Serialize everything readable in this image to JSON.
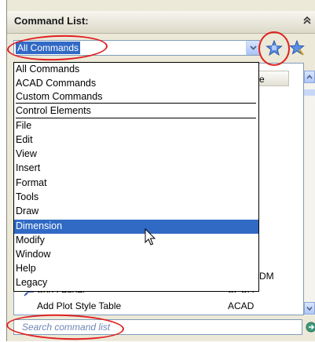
{
  "panel": {
    "title": "Command List:",
    "collapse_icon": "double-chevron-up-icon"
  },
  "filter": {
    "selected": "All Commands",
    "find_star_icon": "star-find-icon",
    "button_star_icon": "star-pin-icon"
  },
  "dropdown": {
    "items": [
      {
        "label": "All Commands"
      },
      {
        "label": "ACAD Commands"
      },
      {
        "label": "Custom Commands"
      },
      {
        "label": "Control Elements"
      },
      {
        "label": "File"
      },
      {
        "label": "Edit"
      },
      {
        "label": "View"
      },
      {
        "label": "Insert"
      },
      {
        "label": "Format"
      },
      {
        "label": "Tools"
      },
      {
        "label": "Draw"
      },
      {
        "label": "Dimension"
      },
      {
        "label": "Modify"
      },
      {
        "label": "Window"
      },
      {
        "label": "Help"
      },
      {
        "label": "Legacy"
      }
    ],
    "highlighted": "Dimension"
  },
  "list": {
    "column_header_partial": "e",
    "rows": [
      {
        "name": "Add Leader",
        "source": "ACAD"
      },
      {
        "name": "Add Plot Style Table",
        "source": "ACAD"
      }
    ],
    "partial_source_text": "DM"
  },
  "search": {
    "placeholder": "Search command list",
    "go_icon": "search-go-icon"
  },
  "colors": {
    "selection": "#316ac5",
    "annotation": "#e02020",
    "panel_bg": "#ece9d8"
  }
}
